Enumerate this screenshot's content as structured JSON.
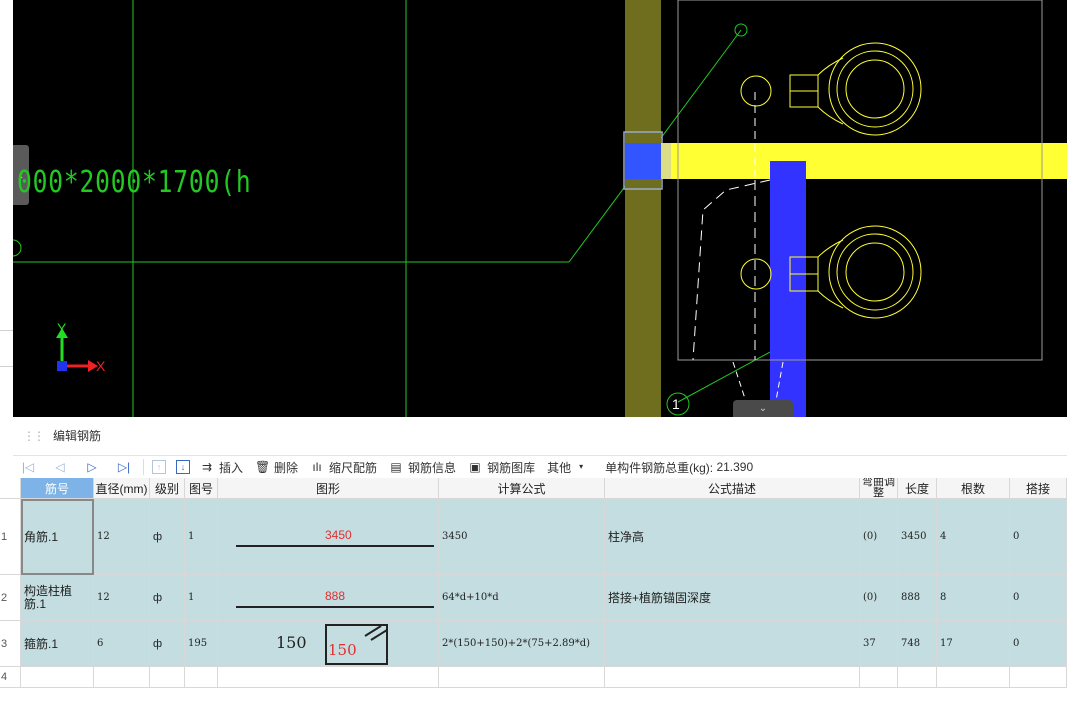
{
  "canvas": {
    "dimension_text": "000*2000*1700(h",
    "axis_y": "Y",
    "axis_x": "X",
    "marker_label": "1"
  },
  "panel": {
    "title": "编辑钢筋"
  },
  "toolbar": {
    "insert": "插入",
    "delete": "删除",
    "scale_rebar": "缩尺配筋",
    "rebar_info": "钢筋信息",
    "rebar_library": "钢筋图库",
    "other": "其他",
    "total_weight_label": "单构件钢筋总重(kg):",
    "total_weight_value": "21.390"
  },
  "table": {
    "headers": [
      "筋号",
      "直径(mm)",
      "级别",
      "图号",
      "图形",
      "计算公式",
      "公式描述",
      "弯曲调整",
      "长度",
      "根数",
      "搭接"
    ],
    "rows": [
      {
        "num": "1",
        "name": "角筋.1",
        "diameter": "12",
        "grade": "ф",
        "figure_no": "1",
        "shape_value": "3450",
        "formula": "3450",
        "description": "柱净高",
        "bend": "(0)",
        "length": "3450",
        "count": "4",
        "lap": "0"
      },
      {
        "num": "2",
        "name": "构造柱植筋.1",
        "diameter": "12",
        "grade": "ф",
        "figure_no": "1",
        "shape_value": "888",
        "formula": "64*d+10*d",
        "description": "搭接+植筋锚固深度",
        "bend": "(0)",
        "length": "888",
        "count": "8",
        "lap": "0"
      },
      {
        "num": "3",
        "name": "箍筋.1",
        "diameter": "6",
        "grade": "ф",
        "figure_no": "195",
        "shape_left": "150",
        "shape_value": "150",
        "formula": "2*(150+150)+2*(75+2.89*d)",
        "description": "",
        "bend": "37",
        "length": "748",
        "count": "17",
        "lap": "0"
      },
      {
        "num": "4"
      }
    ]
  },
  "colors": {
    "row_bg": "#c3dde0",
    "header_selected": "#7db3e6",
    "cad_green": "#22c922",
    "cad_yellow": "#ffff33",
    "cad_blue": "#3333ff",
    "cad_olive": "#6e6e1e"
  }
}
